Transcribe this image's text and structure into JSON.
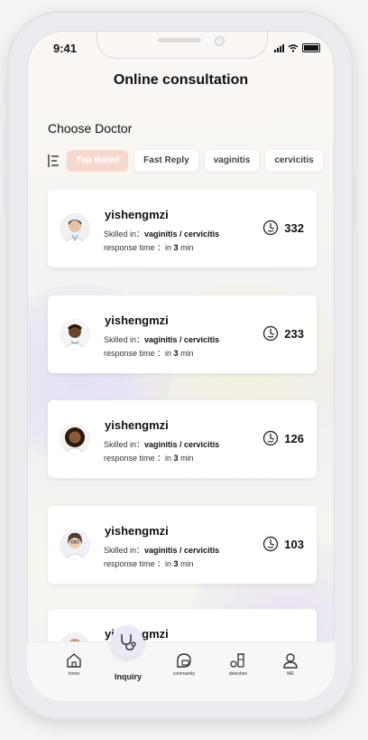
{
  "status_bar": {
    "time": "9:41"
  },
  "header": {
    "title": "Online consultation"
  },
  "section": {
    "title": "Choose Doctor"
  },
  "filters": [
    {
      "label": "Top Rated",
      "active": true
    },
    {
      "label": "Fast Reply",
      "active": false
    },
    {
      "label": "vaginitis",
      "active": false
    },
    {
      "label": "cervicitis",
      "active": false
    }
  ],
  "doctors": [
    {
      "name": "yishengmzi",
      "skill_prefix": "Skilled in：",
      "skills": "vaginitis / cervicitis",
      "response_prefix": "response time ：in ",
      "response_value": "3",
      "response_unit": " min",
      "count": "332"
    },
    {
      "name": "yishengmzi",
      "skill_prefix": "Skilled in：",
      "skills": "vaginitis / cervicitis",
      "response_prefix": "response time ：in ",
      "response_value": "3",
      "response_unit": " min",
      "count": "233"
    },
    {
      "name": "yishengmzi",
      "skill_prefix": "Skilled in：",
      "skills": "vaginitis / cervicitis",
      "response_prefix": "response time ：in ",
      "response_value": "3",
      "response_unit": " min",
      "count": "126"
    },
    {
      "name": "yishengmzi",
      "skill_prefix": "Skilled in：",
      "skills": "vaginitis / cervicitis",
      "response_prefix": "response time ：in ",
      "response_value": "3",
      "response_unit": " min",
      "count": "103"
    },
    {
      "name": "yishengmzi"
    }
  ],
  "tabbar": {
    "home": "home",
    "inquiry": "Inquiry",
    "community": "community",
    "detection": "detection",
    "me": "ME"
  },
  "colors": {
    "active_chip": "#f6d8cf",
    "icon_stroke": "#333333"
  }
}
